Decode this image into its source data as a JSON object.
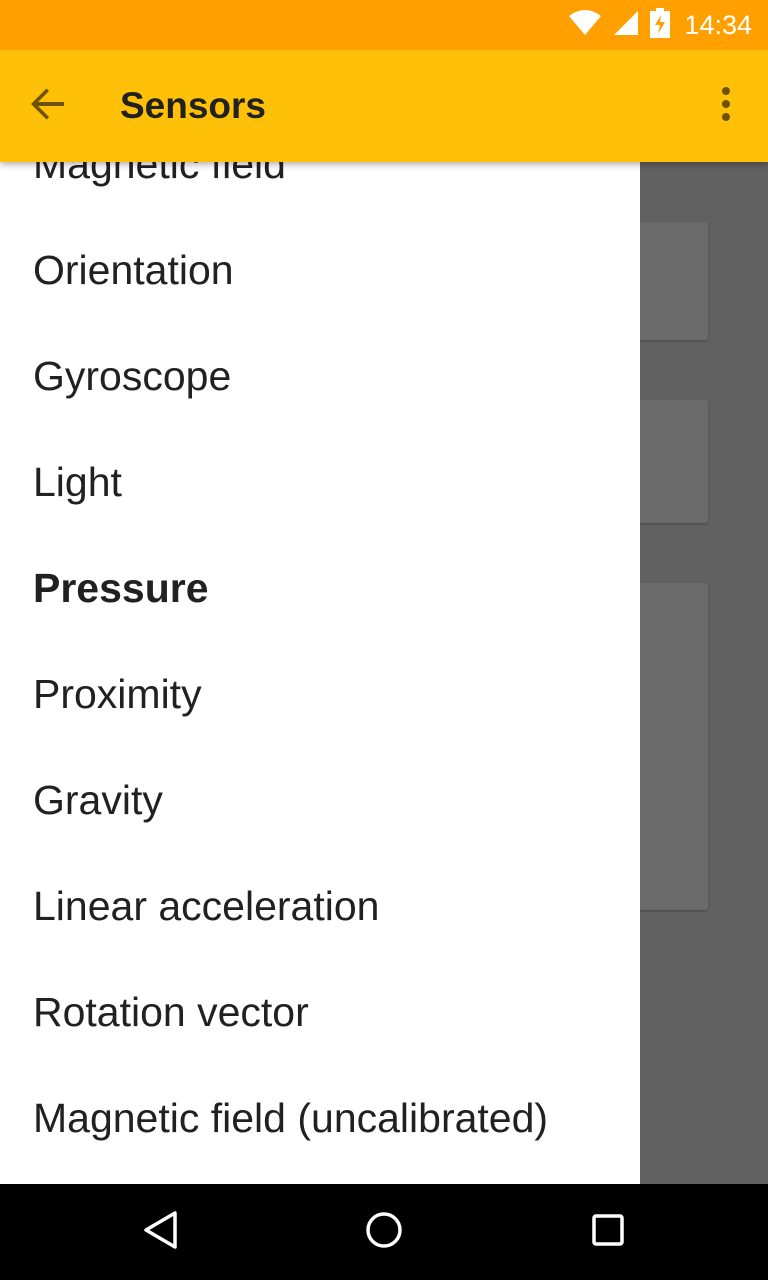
{
  "status_bar": {
    "time": "14:34",
    "icons": [
      "wifi-icon",
      "cell-signal-icon",
      "battery-charging-icon"
    ]
  },
  "app_bar": {
    "title": "Sensors",
    "back_icon": "arrow-back-icon",
    "menu_icon": "more-vert-icon"
  },
  "drawer": {
    "items": [
      {
        "label": "Magnetic field",
        "active": false
      },
      {
        "label": "Orientation",
        "active": false
      },
      {
        "label": "Gyroscope",
        "active": false
      },
      {
        "label": "Light",
        "active": false
      },
      {
        "label": "Pressure",
        "active": true
      },
      {
        "label": "Proximity",
        "active": false
      },
      {
        "label": "Gravity",
        "active": false
      },
      {
        "label": "Linear acceleration",
        "active": false
      },
      {
        "label": "Rotation vector",
        "active": false
      },
      {
        "label": "Magnetic field (uncalibrated)",
        "active": false
      }
    ]
  },
  "nav_bar": {
    "icons": [
      "back-triangle-icon",
      "home-circle-icon",
      "recents-square-icon"
    ]
  },
  "colors": {
    "status_bar": "#FFA000",
    "app_bar": "#FFC107",
    "scrim": "#616161",
    "drawer": "#FFFFFF",
    "text": "#212121"
  }
}
